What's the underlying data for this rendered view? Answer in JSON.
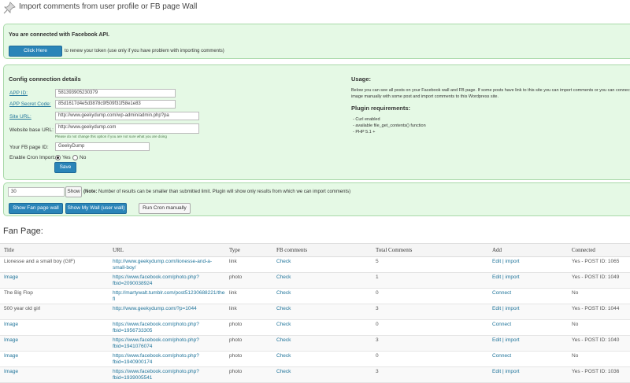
{
  "header": {
    "title": "Import comments from user profile or FB page Wall",
    "icon": "pushpin-icon"
  },
  "connection": {
    "status_text": "You are connected with Facebook API.",
    "button_label": "Click Here",
    "renew_text": "to renew your token (use only if you have problem with importing comments)"
  },
  "config": {
    "title": "Config connection details",
    "app_id_label": "APP ID:",
    "app_id_value": "581393905230379",
    "app_secret_label": "APP Secret Code:",
    "app_secret_value": "85d1617d4e5d3878c9f509f31f58e1e83",
    "site_url_label": "Site URL:",
    "site_url_value": "http://www.geekydump.com/wp-admin/admin.php?pa",
    "website_base_label": "Website base URL:",
    "website_base_value": "http://www.geekydump.com",
    "hint": "Please do not change this option if you are not sure what you are doing",
    "fb_page_label": "Your FB page ID:",
    "fb_page_value": "GeekyDump",
    "cron_label": "Enable Cron Import:",
    "cron_yes": "Yes",
    "cron_no": "No",
    "save_label": "Save"
  },
  "usage": {
    "title": "Usage:",
    "text": "Below you can see all posts on your Facebook wall and FB page. If some posts have link to this site you can import comments or you can connect image manually with some post and import comments to this Wordpress site.",
    "req_title": "Plugin requirements:",
    "req_items": [
      "- Curl enabled",
      "- available file_get_contents() function",
      "- PHP 5.1 +"
    ]
  },
  "fetch": {
    "count_value": "30",
    "show_label": "Show",
    "note_bold": "(Note:",
    "note_text": " Number of results can be smaller than submitted limit. Plugin will show only results from which we can import comments)",
    "fan_wall_label": "Show Fan page wall",
    "my_wall_label": "Show My Wall (user wall)",
    "cron_label": "Run Cron manually"
  },
  "fan_page": {
    "title": "Fan Page:",
    "columns": [
      "Title",
      "URL",
      "Type",
      "FB comments",
      "Total Comments",
      "Add",
      "Connected"
    ],
    "rows": [
      {
        "title": "Lionesse and a small boy (GIF)",
        "url": "http://www.geekydump.com/lionesse-and-a-small-boy/",
        "type": "link",
        "fb": "Check",
        "total": "5",
        "add": "Edit | import",
        "connected": "Yes - POST ID: 1065"
      },
      {
        "title": "Image",
        "url": "https://www.facebook.com/photo.php?fbid=2090038924",
        "type": "photo",
        "fb": "Check",
        "total": "1",
        "add": "Edit | import",
        "connected": "Yes - POST ID: 1049"
      },
      {
        "title": "The Big Flop",
        "url": "http://martywalt.tumblr.com/post51230688221/the-fl",
        "type": "link",
        "fb": "Check",
        "total": "0",
        "add": "Connect",
        "connected": "No"
      },
      {
        "title": "500 year old girl",
        "url": "http://www.geekydump.com/?p=1044",
        "type": "link",
        "fb": "Check",
        "total": "3",
        "add": "Edit | import",
        "connected": "Yes - POST ID: 1044"
      },
      {
        "title": "Image",
        "url": "https://www.facebook.com/photo.php?fbid=1956733305",
        "type": "photo",
        "fb": "Check",
        "total": "0",
        "add": "Connect",
        "connected": "No"
      },
      {
        "title": "Image",
        "url": "https://www.facebook.com/photo.php?fbid=1941076074",
        "type": "photo",
        "fb": "Check",
        "total": "3",
        "add": "Edit | import",
        "connected": "Yes - POST ID: 1040"
      },
      {
        "title": "Image",
        "url": "https://www.facebook.com/photo.php?fbid=1940900174",
        "type": "photo",
        "fb": "Check",
        "total": "0",
        "add": "Connect",
        "connected": "No"
      },
      {
        "title": "Image",
        "url": "https://www.facebook.com/photo.php?fbid=1939005541",
        "type": "photo",
        "fb": "Check",
        "total": "3",
        "add": "Edit | import",
        "connected": "Yes - POST ID: 1036"
      }
    ]
  }
}
